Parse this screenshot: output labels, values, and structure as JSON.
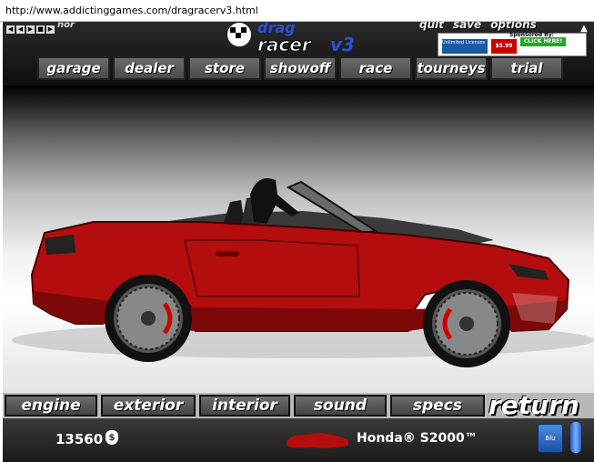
{
  "browser": {
    "url": "http://www.addictinggames.com/dragracerv3.html"
  },
  "game": {
    "media_label": "nor",
    "logo_text": "drag racer v3",
    "top_menu": [
      "quit",
      "save",
      "options"
    ],
    "sponsor": {
      "label": "Sponsored By:",
      "ad1": "Unlimited Licenses",
      "ad2": "$5.99",
      "ad3": "CLICK HERE!"
    },
    "nav": [
      "garage",
      "dealer",
      "store",
      "showoff",
      "race",
      "tourneys",
      "trial"
    ],
    "car": {
      "color": "#b30d0d"
    },
    "tabs": [
      "engine",
      "exterior",
      "interior",
      "sound",
      "specs"
    ],
    "return_label": "return",
    "money": "13560",
    "money_icon": "$",
    "car_name": "Honda® S2000™",
    "fuel_label": "Blu",
    "colors": {
      "accent_red": "#b30d0d",
      "bar_dark": "#1a1a1a"
    }
  }
}
